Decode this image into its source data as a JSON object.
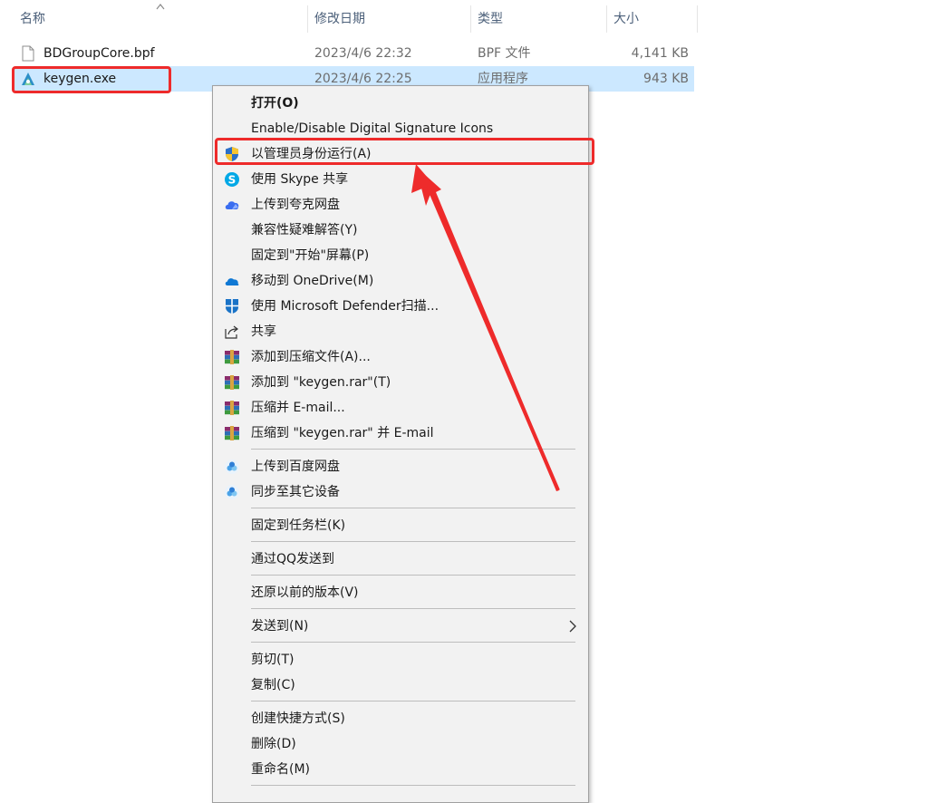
{
  "header": {
    "name": "名称",
    "date": "修改日期",
    "type": "类型",
    "size": "大小"
  },
  "files": [
    {
      "name": "BDGroupCore.bpf",
      "date": "2023/4/6 22:32",
      "type": "BPF 文件",
      "size": "4,141 KB",
      "icon": "file-icon",
      "selected": false
    },
    {
      "name": "keygen.exe",
      "date": "2023/4/6 22:25",
      "type": "应用程序",
      "size": "943 KB",
      "icon": "keygen-app-icon",
      "selected": true
    }
  ],
  "menu": {
    "open": "打开(O)",
    "sig": "Enable/Disable Digital Signature Icons",
    "runas": "以管理员身份运行(A)",
    "skype": "使用 Skype 共享",
    "quark": "上传到夸克网盘",
    "compat": "兼容性疑难解答(Y)",
    "pinstart": "固定到\"开始\"屏幕(P)",
    "onedrive": "移动到 OneDrive(M)",
    "defender": "使用 Microsoft Defender扫描...",
    "share": "共享",
    "addarc": "添加到压缩文件(A)...",
    "addrar": "添加到 \"keygen.rar\"(T)",
    "zipmail": "压缩并 E-mail...",
    "rarmail": "压缩到 \"keygen.rar\" 并 E-mail",
    "baidu": "上传到百度网盘",
    "sync": "同步至其它设备",
    "pintask": "固定到任务栏(K)",
    "qq": "通过QQ发送到",
    "restore": "还原以前的版本(V)",
    "sendto": "发送到(N)",
    "cut": "剪切(T)",
    "copy": "复制(C)",
    "shortcut": "创建快捷方式(S)",
    "delete": "删除(D)",
    "rename": "重命名(M)"
  },
  "colors": {
    "selection": "#cce8ff",
    "highlight": "#ee2b2b",
    "menu_bg": "#f2f2f2"
  }
}
